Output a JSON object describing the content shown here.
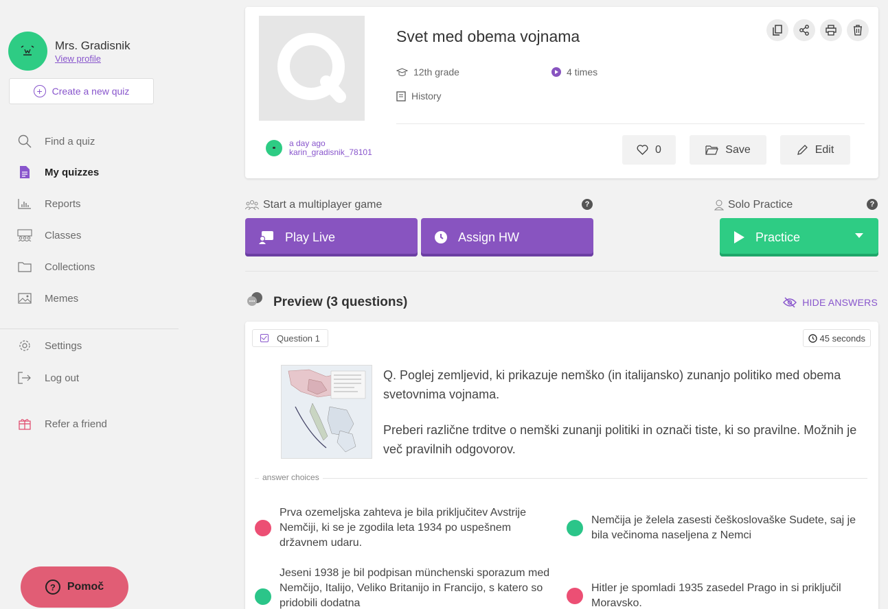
{
  "user": {
    "name": "Mrs. Gradisnik",
    "view_profile": "View profile"
  },
  "sidebar": {
    "create_label": "Create a new quiz",
    "items": [
      {
        "label": "Find a quiz",
        "icon": "search-icon"
      },
      {
        "label": "My quizzes",
        "icon": "document-icon",
        "active": true
      },
      {
        "label": "Reports",
        "icon": "bar-chart-icon"
      },
      {
        "label": "Classes",
        "icon": "people-icon"
      },
      {
        "label": "Collections",
        "icon": "folder-icon"
      },
      {
        "label": "Memes",
        "icon": "image-icon"
      },
      {
        "label": "Settings",
        "icon": "gear-icon"
      },
      {
        "label": "Log out",
        "icon": "logout-icon"
      },
      {
        "label": "Refer a friend",
        "icon": "gift-icon"
      }
    ],
    "help_label": "Pomoč"
  },
  "quiz": {
    "title": "Svet med obema vojnama",
    "grade": "12th grade",
    "plays": "4 times",
    "subject": "History",
    "created": "a day ago",
    "author": "karin_gradisnik_78101",
    "likes": "0",
    "save_label": "Save",
    "edit_label": "Edit"
  },
  "game": {
    "multiplayer_label": "Start a multiplayer game",
    "solo_label": "Solo Practice",
    "play_live": "Play Live",
    "assign_hw": "Assign HW",
    "practice": "Practice",
    "help_mark": "?"
  },
  "preview": {
    "title": "Preview (3 questions)",
    "hide_answers": "HIDE ANSWERS",
    "question_label": "Question 1",
    "time": "45 seconds",
    "question_text_1": "Q. Poglej zemljevid, ki prikazuje nemško (in italijansko) zunanjo politiko med obema svetovnima vojnama.",
    "question_text_2": "Preberi različne trditve o nemški zunanji politiki in označi tiste, ki so pravilne. Možnih je več pravilnih odgovorov.",
    "answer_choices_label": "answer choices",
    "answers": [
      {
        "text": "Prva ozemeljska zahteva je bila priključitev Avstrije Nemčiji, ki se je zgodila leta 1934 po uspešnem državnem udaru.",
        "correct": false
      },
      {
        "text": "Nemčija je želela zasesti češkoslovaške Sudete, saj je bila večinoma naseljena z Nemci",
        "correct": true
      },
      {
        "text": "Jeseni 1938 je bil podpisan münchenski sporazum med Nemčijo, Italijo, Veliko Britanijo in Francijo, s katero so pridobili dodatna",
        "correct": true
      },
      {
        "text": "Hitler je spomladi 1935 zasedel Prago in si priključil Moravsko.",
        "correct": false
      }
    ]
  },
  "colors": {
    "accent": "#8854c0",
    "green": "#2ecc84",
    "wrong": "#ec4f74",
    "help": "#e15d75"
  }
}
